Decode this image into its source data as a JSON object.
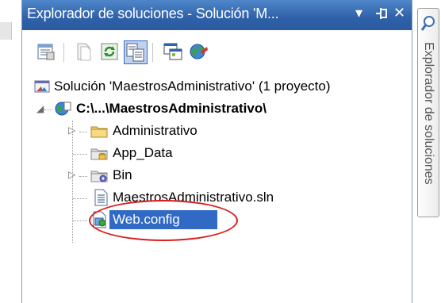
{
  "panel": {
    "title": "Explorador de soluciones - Solución 'M...",
    "pin_glyph": "▾",
    "autohide_glyph": "⊣",
    "close_glyph": "✕"
  },
  "toolbar": {
    "buttons": [
      {
        "name": "properties-icon"
      },
      {
        "name": "show-all-files-icon"
      },
      {
        "name": "refresh-icon"
      },
      {
        "name": "nest-related-files-icon",
        "active": true
      },
      {
        "name": "view-designer-icon"
      },
      {
        "name": "configure-icon"
      }
    ]
  },
  "tree": {
    "solution_label": "Solución 'MaestrosAdministrativo' (1 proyecto)",
    "project_label": "C:\\...\\MaestrosAdministrativo\\",
    "items": [
      {
        "label": "Administrativo",
        "icon": "folder-icon",
        "expandable": true
      },
      {
        "label": "App_Data",
        "icon": "app-data-folder-icon",
        "expandable": false
      },
      {
        "label": "Bin",
        "icon": "bin-folder-icon",
        "expandable": true
      },
      {
        "label": "MaestrosAdministrativo.sln",
        "icon": "solution-file-icon",
        "expandable": false
      },
      {
        "label": "Web.config",
        "icon": "config-file-icon",
        "expandable": false,
        "selected": true
      }
    ]
  },
  "side_tab": {
    "label": "Explorador de soluciones"
  },
  "colors": {
    "title_bar": "#2f61a9",
    "selection": "#316ac5",
    "annotation": "#d81e1e"
  }
}
